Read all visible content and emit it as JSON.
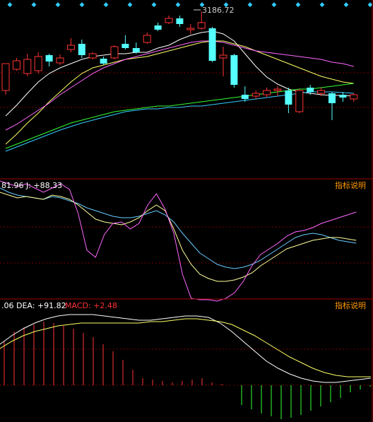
{
  "chart_data": [
    {
      "type": "candlestick",
      "annotation_high": "3186.72",
      "candles": [
        {
          "o": 86,
          "c": 124,
          "h": 88,
          "l": 130,
          "d": "up"
        },
        {
          "o": 82,
          "c": 94,
          "h": 78,
          "l": 96,
          "d": "up"
        },
        {
          "o": 80,
          "c": 100,
          "h": 72,
          "l": 104,
          "d": "up"
        },
        {
          "o": 76,
          "c": 96,
          "h": 70,
          "l": 100,
          "d": "up"
        },
        {
          "o": 74,
          "c": 83,
          "h": 72,
          "l": 90,
          "d": "down"
        },
        {
          "o": 78,
          "c": 85,
          "h": 73,
          "l": 88,
          "d": "up"
        },
        {
          "o": 60,
          "c": 66,
          "h": 50,
          "l": 70,
          "d": "up"
        },
        {
          "o": 58,
          "c": 74,
          "h": 52,
          "l": 78,
          "d": "down"
        },
        {
          "o": 72,
          "c": 78,
          "h": 70,
          "l": 80,
          "d": "up"
        },
        {
          "o": 79,
          "c": 86,
          "h": 76,
          "l": 88,
          "d": "down"
        },
        {
          "o": 62,
          "c": 78,
          "h": 60,
          "l": 80,
          "d": "up"
        },
        {
          "o": 58,
          "c": 64,
          "h": 46,
          "l": 66,
          "d": "down"
        },
        {
          "o": 64,
          "c": 70,
          "h": 56,
          "l": 72,
          "d": "down"
        },
        {
          "o": 46,
          "c": 56,
          "h": 42,
          "l": 58,
          "d": "up"
        },
        {
          "o": 32,
          "c": 38,
          "h": 28,
          "l": 40,
          "d": "down"
        },
        {
          "o": 22,
          "c": 28,
          "h": 18,
          "l": 30,
          "d": "up"
        },
        {
          "o": 22,
          "c": 30,
          "h": 18,
          "l": 34,
          "d": "down"
        },
        {
          "o": 36,
          "c": 38,
          "h": 30,
          "l": 44,
          "d": "up"
        },
        {
          "o": 28,
          "c": 36,
          "h": 12,
          "l": 38,
          "d": "up"
        },
        {
          "o": 36,
          "c": 82,
          "h": 34,
          "l": 84,
          "d": "down"
        },
        {
          "o": 74,
          "c": 78,
          "h": 62,
          "l": 104,
          "d": "up"
        },
        {
          "o": 74,
          "c": 116,
          "h": 72,
          "l": 120,
          "d": "down"
        },
        {
          "o": 130,
          "c": 136,
          "h": 118,
          "l": 140,
          "d": "down"
        },
        {
          "o": 128,
          "c": 132,
          "h": 124,
          "l": 136,
          "d": "up"
        },
        {
          "o": 124,
          "c": 130,
          "h": 120,
          "l": 134,
          "d": "up"
        },
        {
          "o": 122,
          "c": 124,
          "h": 118,
          "l": 132,
          "d": "up"
        },
        {
          "o": 124,
          "c": 144,
          "h": 120,
          "l": 156,
          "d": "down"
        },
        {
          "o": 124,
          "c": 154,
          "h": 122,
          "l": 156,
          "d": "up"
        },
        {
          "o": 120,
          "c": 126,
          "h": 116,
          "l": 130,
          "d": "down"
        },
        {
          "o": 124,
          "c": 128,
          "h": 120,
          "l": 132,
          "d": "up"
        },
        {
          "o": 128,
          "c": 142,
          "h": 126,
          "l": 166,
          "d": "down"
        },
        {
          "o": 130,
          "c": 134,
          "h": 126,
          "l": 140,
          "d": "down"
        },
        {
          "o": 130,
          "c": 136,
          "h": 128,
          "l": 140,
          "d": "up"
        }
      ],
      "moving_averages": [
        {
          "color": "#ffffff",
          "y": [
            160,
            145,
            128,
            112,
            100,
            92,
            86,
            80,
            76,
            74,
            72,
            72,
            70,
            70,
            64,
            60,
            52,
            46,
            42,
            40,
            44,
            54,
            72,
            90,
            105,
            115,
            122,
            126,
            128,
            130,
            131,
            131,
            132
          ]
        },
        {
          "color": "#ffff66",
          "y": [
            200,
            186,
            170,
            156,
            140,
            126,
            112,
            100,
            92,
            88,
            84,
            80,
            78,
            76,
            72,
            68,
            64,
            60,
            56,
            54,
            54,
            58,
            62,
            68,
            74,
            80,
            86,
            92,
            98,
            104,
            108,
            112,
            114
          ]
        },
        {
          "color": "#ff66ff",
          "y": [
            180,
            172,
            162,
            152,
            142,
            130,
            120,
            110,
            100,
            92,
            86,
            80,
            76,
            72,
            68,
            64,
            60,
            56,
            54,
            54,
            56,
            60,
            64,
            68,
            70,
            72,
            74,
            76,
            78,
            80,
            84,
            86,
            90
          ]
        },
        {
          "color": "#33ff33",
          "y": [
            206,
            200,
            194,
            188,
            182,
            176,
            170,
            166,
            162,
            158,
            154,
            152,
            150,
            148,
            146,
            146,
            144,
            142,
            140,
            138,
            136,
            134,
            132,
            130,
            128,
            126,
            124,
            122,
            122,
            120,
            118,
            116,
            114
          ]
        },
        {
          "color": "#33ccff",
          "y": [
            210,
            204,
            198,
            192,
            186,
            180,
            175,
            170,
            166,
            162,
            158,
            154,
            152,
            150,
            150,
            148,
            148,
            146,
            146,
            144,
            142,
            140,
            138,
            136,
            134,
            132,
            130,
            128,
            126,
            126,
            126,
            127,
            128
          ]
        }
      ]
    },
    {
      "type": "line",
      "label": "81.96 J: +88.33",
      "series": [
        {
          "color": "#66ccff",
          "values": [
            10,
            16,
            20,
            22,
            24,
            26,
            22,
            24,
            28,
            32,
            38,
            42,
            46,
            50,
            52,
            52,
            50,
            46,
            42,
            48,
            58,
            74,
            88,
            102,
            110,
            118,
            122,
            124,
            122,
            118,
            112,
            104,
            96,
            88,
            80,
            76,
            74,
            76,
            80,
            84,
            86,
            88
          ]
        },
        {
          "color": "#ffff99",
          "values": [
            16,
            20,
            24,
            22,
            24,
            26,
            20,
            22,
            26,
            34,
            44,
            54,
            58,
            60,
            62,
            58,
            52,
            42,
            34,
            42,
            68,
            98,
            118,
            132,
            138,
            142,
            142,
            140,
            136,
            130,
            120,
            112,
            104,
            96,
            92,
            88,
            84,
            82,
            80,
            80,
            82,
            84
          ]
        },
        {
          "color": "#ff66ff",
          "values": [
            0,
            4,
            8,
            4,
            10,
            16,
            10,
            4,
            12,
            46,
            98,
            108,
            76,
            60,
            58,
            68,
            60,
            34,
            18,
            40,
            74,
            132,
            166,
            168,
            168,
            170,
            166,
            158,
            142,
            120,
            104,
            96,
            88,
            78,
            72,
            70,
            66,
            60,
            56,
            52,
            48,
            44
          ]
        }
      ]
    },
    {
      "type": "bar_line",
      "label": ".06 DEA: +91.82 MACD: +2.48",
      "bars": [
        62,
        76,
        82,
        86,
        90,
        88,
        84,
        80,
        74,
        68,
        58,
        48,
        36,
        22,
        10,
        8,
        6,
        4,
        6,
        8,
        10,
        4,
        2,
        0,
        -28,
        -34,
        -40,
        -44,
        -48,
        -46,
        -42,
        -36,
        -30,
        -24,
        -18,
        -10,
        -6,
        -2
      ],
      "series": [
        {
          "color": "#ffffff",
          "values": [
            40,
            52,
            62,
            70,
            76,
            80,
            82,
            82,
            82,
            80,
            78,
            76,
            74,
            74,
            76,
            78,
            80,
            80,
            78,
            70,
            58,
            44,
            30,
            16,
            6,
            -2,
            -8,
            -12,
            -14,
            -14,
            -12,
            -10,
            -8
          ]
        },
        {
          "color": "#ffff66",
          "values": [
            34,
            44,
            52,
            58,
            62,
            66,
            68,
            70,
            70,
            70,
            70,
            70,
            70,
            72,
            72,
            74,
            76,
            76,
            74,
            72,
            68,
            60,
            52,
            42,
            32,
            22,
            14,
            6,
            0,
            -4,
            -6,
            -6,
            -6
          ]
        }
      ]
    }
  ],
  "ui": {
    "kdj_label": "81.96 J: +88.33",
    "macd_dea": ".06 DEA: +91.82",
    "macd_value": "MACD: +2.48",
    "help": "指标说明",
    "top_markers": [
      "◆",
      "◆",
      "◆",
      "◆",
      "◆",
      "◆",
      "◆",
      "◆",
      "◆",
      "◆",
      "◆",
      "◆",
      "◆",
      "◆",
      "◆",
      "◆",
      "◆"
    ]
  }
}
